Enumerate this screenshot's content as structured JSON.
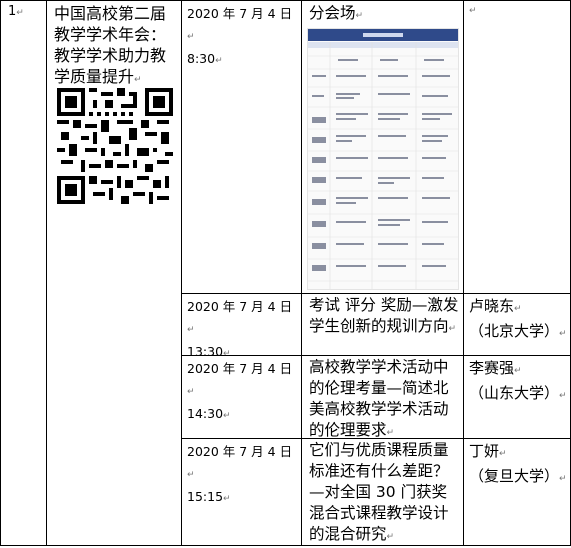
{
  "row": {
    "index": "1",
    "event_title": "中国高校第二届教学学术年会：教学学术助力教学质量提升",
    "qr_code_icon": "qr-code-icon"
  },
  "sessions": [
    {
      "date": "2020 年 7 月 4 日",
      "time": "8:30",
      "topic": "分会场",
      "speaker": "",
      "affiliation": ""
    },
    {
      "date": "2020 年 7 月 4 日",
      "time": "13:30",
      "topic": "考试 评分 奖励—激发学生创新的规训方向",
      "speaker": "卢晓东",
      "affiliation": "（北京大学）"
    },
    {
      "date": "2020 年 7 月 4 日",
      "time": "14:30",
      "topic": "高校教学学术活动中的伦理考量—简述北美高校教学学术活动的伦理要求",
      "speaker": "李赛强",
      "affiliation": "（山东大学）"
    },
    {
      "date": "2020 年 7 月 4 日",
      "time": "15:15",
      "topic": "它们与优质课程质量标准还有什么差距？—对全国 30 门获奖混合式课程教学设计的混合研究",
      "speaker": "丁妍",
      "affiliation": "（复旦大学）"
    }
  ],
  "thumbnail_icon": "schedule-table-thumbnail",
  "colors": {
    "thumbnail_header": "#2f4a8a",
    "border": "#000000"
  }
}
